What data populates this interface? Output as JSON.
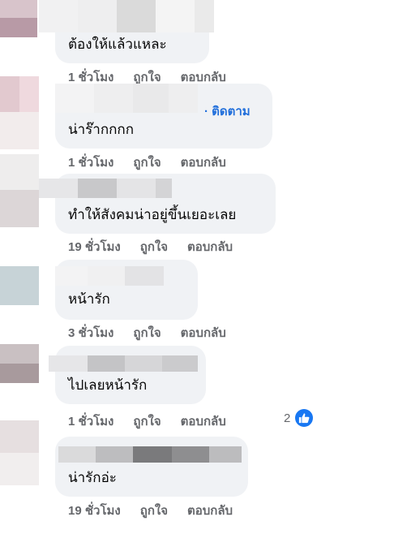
{
  "comments": [
    {
      "text": "ต้องให้แล้วแหละ",
      "time": "1 ชั่วโมง",
      "like": "ถูกใจ",
      "reply": "ตอบกลับ"
    },
    {
      "text": "น่าร๊ากกกก",
      "follow": "· ติดตาม",
      "time": "1 ชั่วโมง",
      "like": "ถูกใจ",
      "reply": "ตอบกลับ"
    },
    {
      "text": "ทำให้สังคมน่าอยู่ขึ้นเยอะเลย",
      "time": "19 ชั่วโมง",
      "like": "ถูกใจ",
      "reply": "ตอบกลับ"
    },
    {
      "text": "หน้ารัก",
      "time": "3 ชั่วโมง",
      "like": "ถูกใจ",
      "reply": "ตอบกลับ"
    },
    {
      "text": "ไปเลยหน้ารัก",
      "time": "1 ชั่วโมง",
      "like": "ถูกใจ",
      "reply": "ตอบกลับ",
      "reaction_count": "2"
    },
    {
      "text": "น่ารักอ่ะ",
      "time": "19 ชั่วโมง",
      "like": "ถูกใจ",
      "reply": "ตอบกลับ"
    }
  ],
  "colors": {
    "bubble": "#f0f2f5",
    "meta": "#65676b",
    "link": "#216fdb",
    "like_badge": "#1877f2"
  },
  "icons": {
    "reaction": "thumbs-up-icon"
  }
}
